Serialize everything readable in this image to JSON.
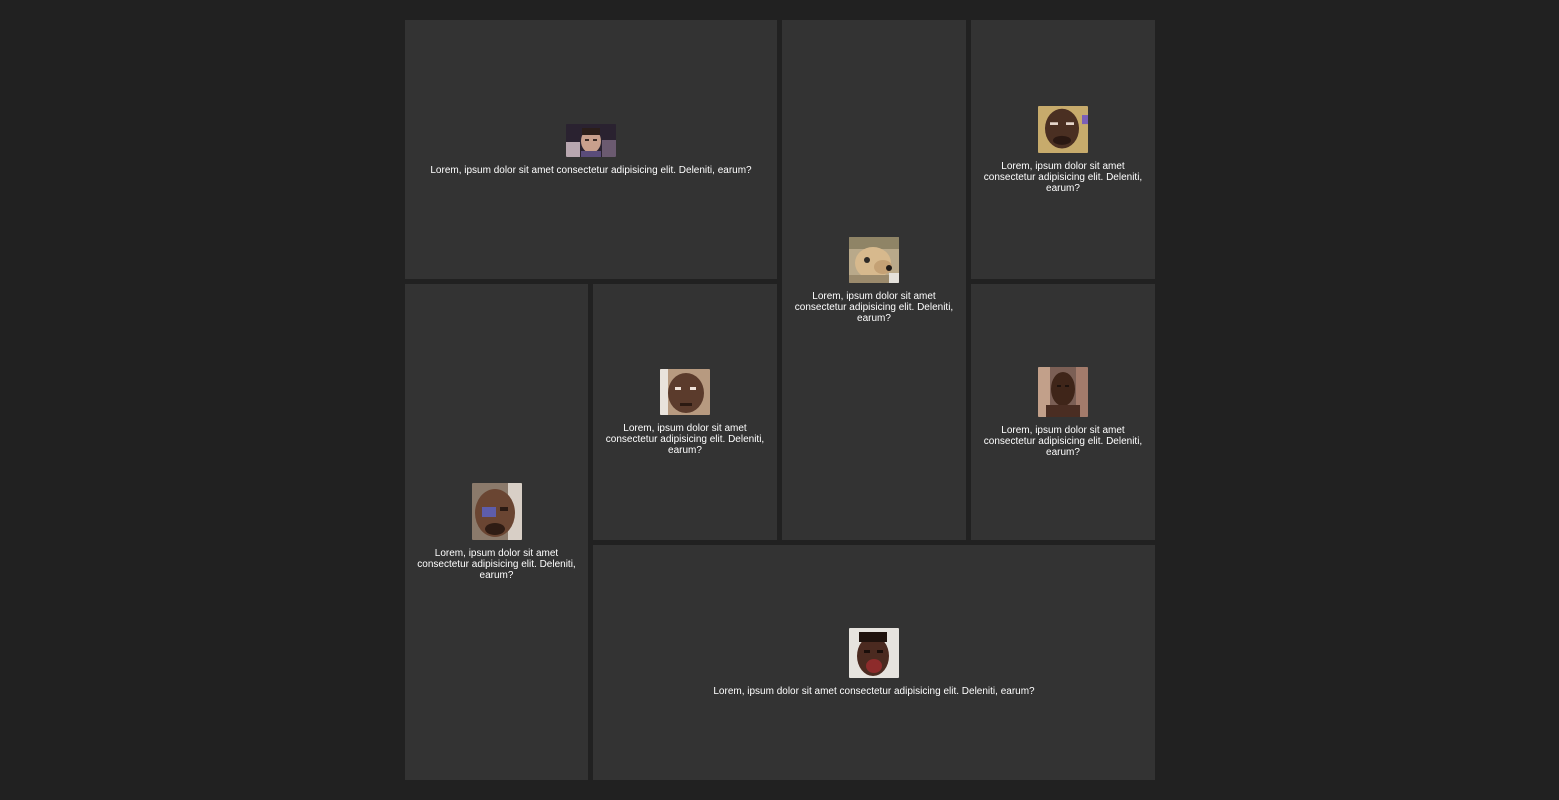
{
  "gallery": {
    "cards": [
      {
        "caption": "Lorem, ipsum dolor sit amet consectetur adipisicing elit. Deleniti, earum?",
        "image": "face-photo-1"
      },
      {
        "caption": "Lorem, ipsum dolor sit amet consectetur adipisicing elit. Deleniti, earum?",
        "image": "dog-photo"
      },
      {
        "caption": "Lorem, ipsum dolor sit amet consectetur adipisicing elit. Deleniti, earum?",
        "image": "face-photo-2"
      },
      {
        "caption": "Lorem, ipsum dolor sit amet consectetur adipisicing elit. Deleniti, earum?",
        "image": "face-photo-3"
      },
      {
        "caption": "Lorem, ipsum dolor sit amet consectetur adipisicing elit. Deleniti, earum?",
        "image": "face-photo-4"
      },
      {
        "caption": "Lorem, ipsum dolor sit amet consectetur adipisicing elit. Deleniti, earum?",
        "image": "face-photo-5"
      },
      {
        "caption": "Lorem, ipsum dolor sit amet consectetur adipisicing elit. Deleniti, earum?",
        "image": "face-photo-6"
      }
    ]
  },
  "colors": {
    "page_background": "#212121",
    "card_background": "#333333",
    "text": "#ffffff"
  }
}
